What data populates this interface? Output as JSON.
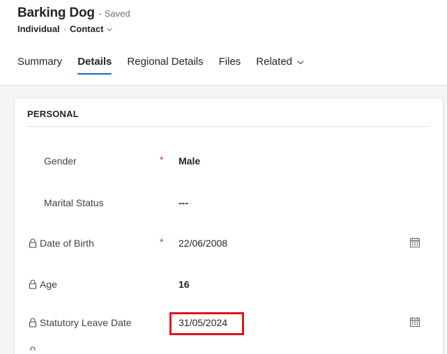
{
  "header": {
    "title": "Barking Dog",
    "saved": "- Saved",
    "entity_type": "Individual",
    "separator": "·",
    "form_name": "Contact"
  },
  "tabs": [
    {
      "label": "Summary"
    },
    {
      "label": "Details",
      "active": true
    },
    {
      "label": "Regional Details"
    },
    {
      "label": "Files"
    },
    {
      "label": "Related"
    }
  ],
  "section": {
    "title": "PERSONAL",
    "fields": [
      {
        "label": "Gender",
        "required": "*",
        "value": "Male",
        "locked": false
      },
      {
        "label": "Marital Status",
        "value": "---",
        "locked": false
      },
      {
        "label": "Date of Birth",
        "required": "*",
        "value": "22/06/2008",
        "locked": true,
        "icon": "calendar-icon"
      },
      {
        "label": "Age",
        "value": "16",
        "locked": true
      },
      {
        "label": "Statutory Leave Date",
        "value": "31/05/2024",
        "locked": true,
        "icon": "calendar-icon",
        "highlighted": true
      }
    ]
  },
  "colors": {
    "accent": "#0f6cbd",
    "required": "#c4314b",
    "highlight": "#e0141e"
  }
}
